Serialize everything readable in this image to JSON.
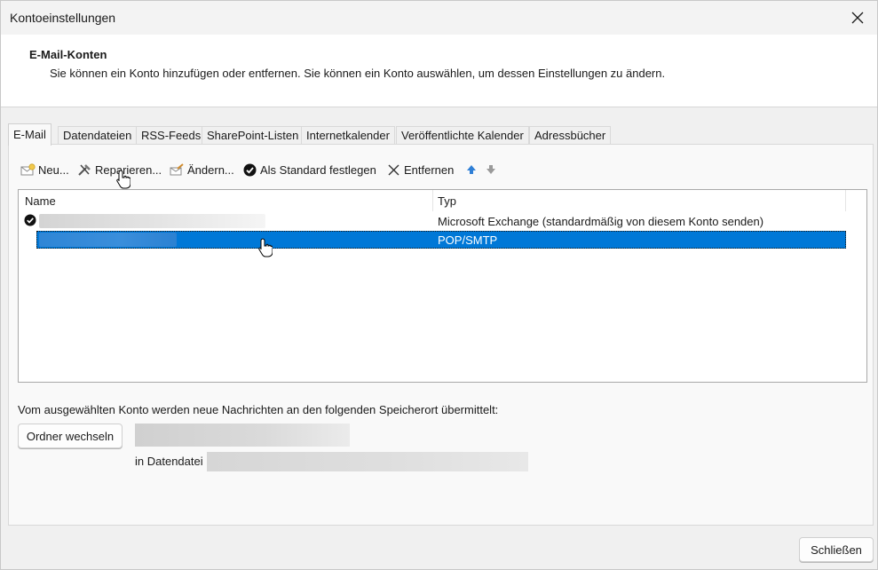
{
  "window": {
    "title": "Kontoeinstellungen",
    "close_icon": "close-icon"
  },
  "header": {
    "title": "E-Mail-Konten",
    "description": "Sie können ein Konto hinzufügen oder entfernen. Sie können ein Konto auswählen, um dessen Einstellungen zu ändern."
  },
  "tabs": [
    {
      "label": "E-Mail",
      "active": true
    },
    {
      "label": "Datendateien",
      "active": false
    },
    {
      "label": "RSS-Feeds",
      "active": false
    },
    {
      "label": "SharePoint-Listen",
      "active": false
    },
    {
      "label": "Internetkalender",
      "active": false
    },
    {
      "label": "Veröffentlichte Kalender",
      "active": false
    },
    {
      "label": "Adressbücher",
      "active": false
    }
  ],
  "toolbar": {
    "new_label": "Neu...",
    "repair_label": "Reparieren...",
    "change_label": "Ändern...",
    "set_default_label": "Als Standard festlegen",
    "remove_label": "Entfernen",
    "move_up_icon": "arrow-up-icon",
    "move_down_icon": "arrow-down-icon"
  },
  "account_list": {
    "columns": [
      "Name",
      "Typ"
    ],
    "rows": [
      {
        "name": "",
        "type": "Microsoft Exchange (standardmäßig von diesem Konto senden)",
        "is_default": true,
        "selected": false
      },
      {
        "name": "",
        "type": "POP/SMTP",
        "is_default": false,
        "selected": true
      }
    ]
  },
  "delivery": {
    "info_text": "Vom ausgewählten Konto werden neue Nachrichten an den folgenden Speicherort übermittelt:",
    "change_folder_label": "Ordner wechseln",
    "datafile_label": "in Datendatei"
  },
  "footer": {
    "close_label": "Schließen"
  },
  "colors": {
    "selection": "#0078d7",
    "header_bg": "#ffffff",
    "window_bg": "#f0f0f0"
  }
}
